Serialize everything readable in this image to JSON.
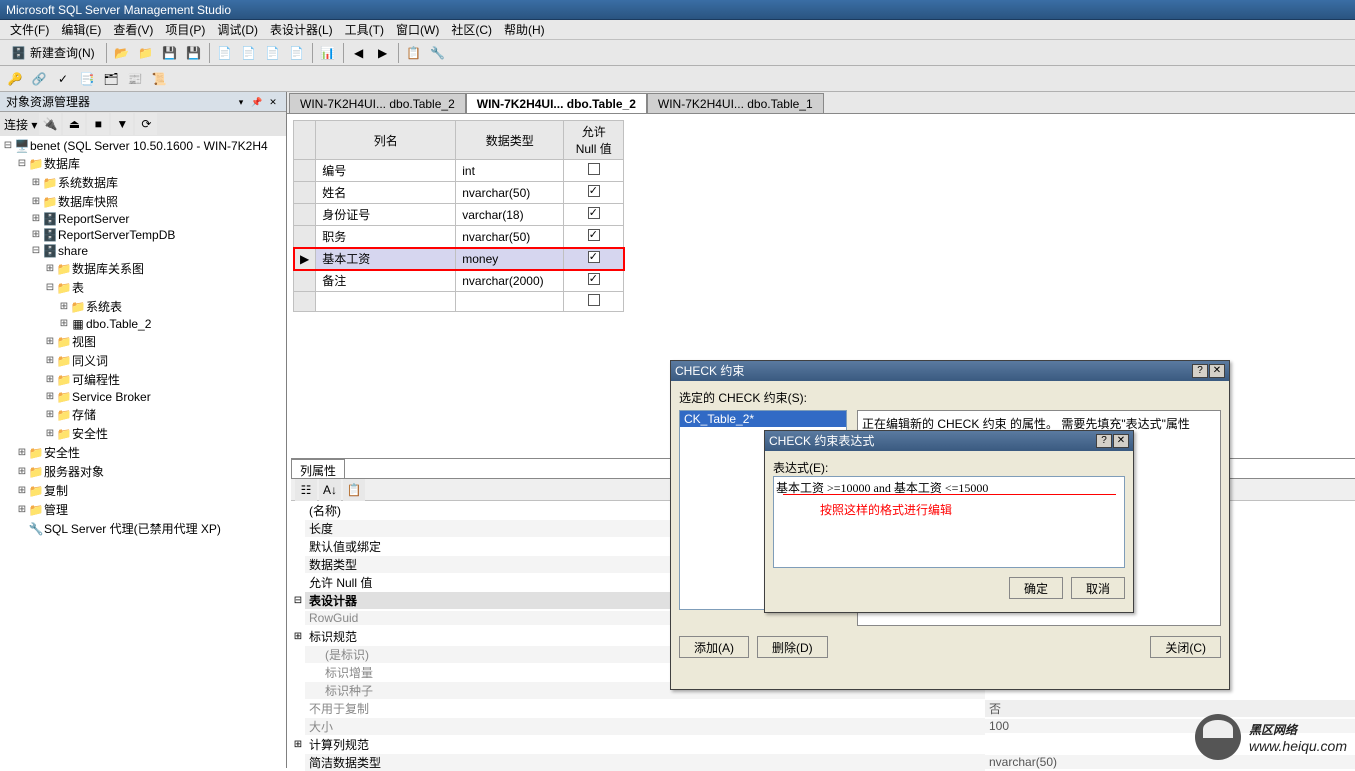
{
  "titlebar": "Microsoft SQL Server Management Studio",
  "menu": {
    "file": "文件(F)",
    "edit": "编辑(E)",
    "view": "查看(V)",
    "project": "项目(P)",
    "debug": "调试(D)",
    "designer": "表设计器(L)",
    "tools": "工具(T)",
    "window": "窗口(W)",
    "community": "社区(C)",
    "help": "帮助(H)"
  },
  "toolbar": {
    "new_query": "新建查询(N)"
  },
  "object_explorer": {
    "title": "对象资源管理器",
    "connect": "连接 ▾",
    "server": "benet (SQL Server 10.50.1600 - WIN-7K2H4",
    "nodes": {
      "databases": "数据库",
      "system_db": "系统数据库",
      "db_snapshots": "数据库快照",
      "report_server": "ReportServer",
      "report_server_temp": "ReportServerTempDB",
      "share": "share",
      "db_diagrams": "数据库关系图",
      "tables": "表",
      "system_tables": "系统表",
      "dbo_table2": "dbo.Table_2",
      "views": "视图",
      "synonyms": "同义词",
      "programmability": "可编程性",
      "service_broker": "Service Broker",
      "storage": "存储",
      "security_db": "安全性",
      "security": "安全性",
      "server_objects": "服务器对象",
      "replication": "复制",
      "management": "管理",
      "sql_agent": "SQL Server 代理(已禁用代理 XP)"
    }
  },
  "tabs": {
    "tab1": "WIN-7K2H4UI... dbo.Table_2",
    "tab2": "WIN-7K2H4UI... dbo.Table_2",
    "tab3": "WIN-7K2H4UI... dbo.Table_1"
  },
  "design_grid": {
    "headers": {
      "col_name": "列名",
      "data_type": "数据类型",
      "allow_null": "允许 Null 值"
    },
    "rows": [
      {
        "name": "编号",
        "type": "int",
        "null": false
      },
      {
        "name": "姓名",
        "type": "nvarchar(50)",
        "null": true
      },
      {
        "name": "身份证号",
        "type": "varchar(18)",
        "null": true
      },
      {
        "name": "职务",
        "type": "nvarchar(50)",
        "null": true
      },
      {
        "name": "基本工资",
        "type": "money",
        "null": true,
        "selected": true
      },
      {
        "name": "备注",
        "type": "nvarchar(2000)",
        "null": true
      }
    ]
  },
  "col_props": {
    "tab": "列属性",
    "rows": {
      "name": "(名称)",
      "length": "长度",
      "default": "默认值或绑定",
      "data_type": "数据类型",
      "allow_null": "允许 Null 值",
      "designer": "表设计器",
      "rowguid": "RowGuid",
      "identity": "标识规范",
      "is_identity": "(是标识)",
      "identity_inc": "标识增量",
      "identity_seed": "标识种子",
      "not_for_rep": "不用于复制",
      "size": "大小",
      "computed": "计算列规范",
      "concise_type": "简洁数据类型",
      "val_no": "否",
      "val_100": "100",
      "val_nvarchar50": "nvarchar(50)"
    }
  },
  "check_dialog": {
    "title": "CHECK 约束",
    "selected_label": "选定的 CHECK 约束(S):",
    "item": "CK_Table_2*",
    "editing_msg": "正在编辑新的 CHECK 约束 的属性。   需要先填充\"表达式\"属性",
    "add": "添加(A)",
    "delete": "删除(D)",
    "close": "关闭(C)"
  },
  "expr_dialog": {
    "title": "CHECK 约束表达式",
    "label": "表达式(E):",
    "value": "基本工资 >=10000 and 基本工资 <=15000",
    "annotation": "按照这样的格式进行编辑",
    "ok": "确定",
    "cancel": "取消"
  },
  "watermark": {
    "brand": "黑区网络",
    "url": "www.heiqu.com"
  }
}
